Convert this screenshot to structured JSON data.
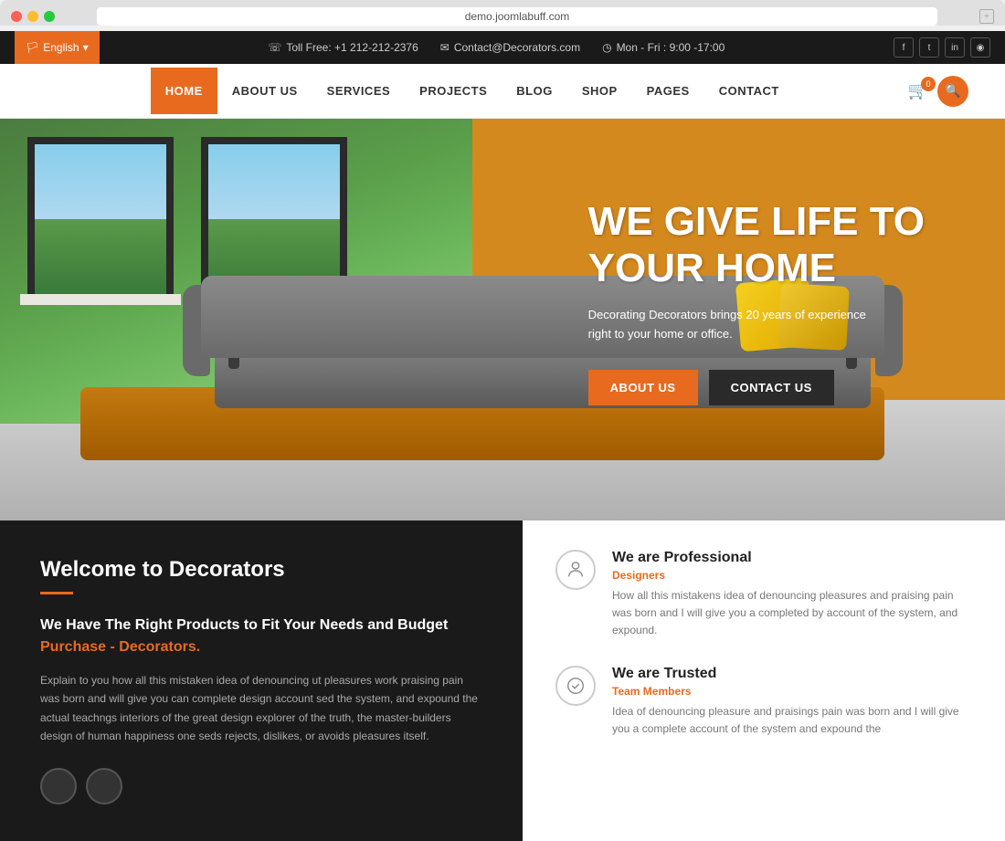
{
  "browser": {
    "url": "demo.joomlabuff.com",
    "dots": [
      "red",
      "yellow",
      "green"
    ]
  },
  "topbar": {
    "lang_label": "English",
    "phone_icon": "☏",
    "phone": "Toll Free: +1 212-212-2376",
    "email_icon": "✉",
    "email": "Contact@Decorators.com",
    "clock_icon": "◷",
    "hours": "Mon - Fri : 9:00 -17:00",
    "social": [
      "f",
      "t",
      "in",
      "♪"
    ]
  },
  "nav": {
    "links": [
      {
        "label": "HOME",
        "active": true
      },
      {
        "label": "ABOUT US",
        "active": false
      },
      {
        "label": "SERVICES",
        "active": false
      },
      {
        "label": "PROJECTS",
        "active": false
      },
      {
        "label": "BLOG",
        "active": false
      },
      {
        "label": "SHOP",
        "active": false
      },
      {
        "label": "PAGES",
        "active": false
      },
      {
        "label": "CONTACT",
        "active": false
      }
    ],
    "cart_count": "0"
  },
  "hero": {
    "title_line1": "WE GIVE LIFE TO",
    "title_line2": "YOUR HOME",
    "subtitle": "Decorating Decorators brings 20 years of experience right to your home or office.",
    "btn_about": "ABOUT US",
    "btn_contact": "CONTACT US"
  },
  "welcome": {
    "title": "Welcome to Decorators",
    "subtitle_part1": "We Have The Right Products to Fit Your Needs and Budget ",
    "subtitle_link": "Purchase - Decorators.",
    "body_text": "Explain to you how all this mistaken idea of denouncing ut pleasures work praising pain was born and will give you can complete design account sed the system, and expound the actual teachngs interiors of the great design explorer of the truth, the master-builders design of human happiness one seds rejects, dislikes, or avoids pleasures itself."
  },
  "features": [
    {
      "icon": "person",
      "title": "We are Professional",
      "tag": "Designers",
      "desc": "How all this mistakens idea of denouncing pleasures and praising pain was born and I will give you a completed by account of the system, and expound."
    },
    {
      "icon": "check",
      "title": "We are Trusted",
      "tag": "Team Members",
      "desc": "Idea of denouncing pleasure and praisings pain was born and I will give you a complete account of the system and expound the"
    }
  ]
}
